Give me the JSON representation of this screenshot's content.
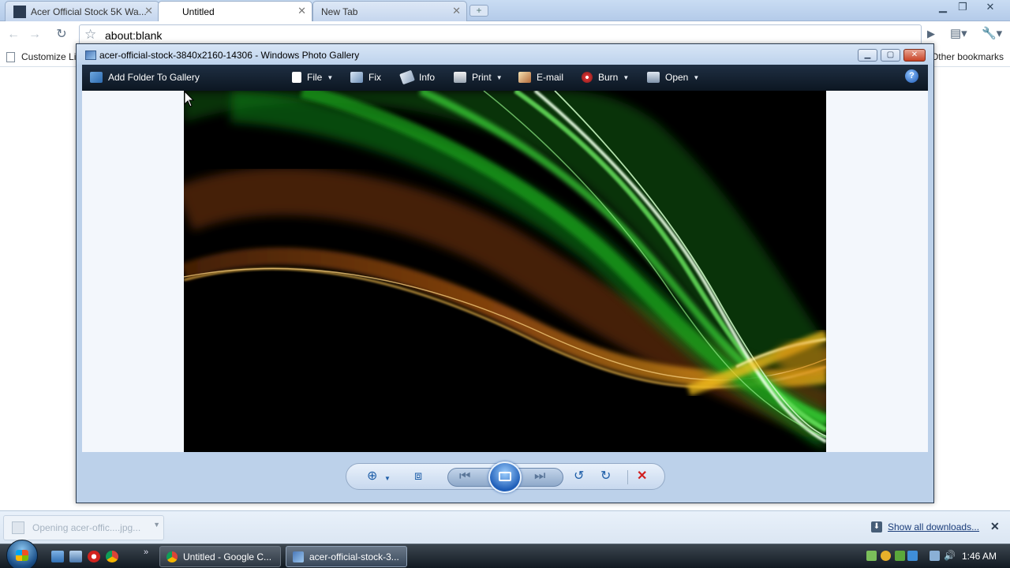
{
  "browser": {
    "tabs": [
      {
        "label": "Acer Official Stock 5K Wa...",
        "active": false
      },
      {
        "label": "Untitled",
        "active": true
      },
      {
        "label": "New Tab",
        "active": false
      }
    ],
    "new_tab_label": "+",
    "address": "about:blank",
    "bookmarks": {
      "customize_label": "Customize Li",
      "other_label": "Other bookmarks"
    }
  },
  "photo_gallery": {
    "title": "acer-official-stock-3840x2160-14306 - Windows Photo Gallery",
    "toolbar": {
      "add_folder": "Add Folder To Gallery",
      "file": "File",
      "fix": "Fix",
      "info": "Info",
      "print": "Print",
      "email": "E-mail",
      "burn": "Burn",
      "open": "Open",
      "help": "?"
    },
    "controls": {
      "zoom": "zoom-icon",
      "fit": "actual-size-icon",
      "previous": "previous-icon",
      "slideshow": "slideshow-icon",
      "next": "next-icon",
      "rotate_left": "rotate-counterclockwise-icon",
      "rotate_right": "rotate-clockwise-icon",
      "delete": "delete-icon"
    }
  },
  "downloads": {
    "item_text": "Opening acer-offic....jpg...",
    "show_all": "Show all downloads..."
  },
  "taskbar": {
    "buttons": [
      {
        "label": "Untitled - Google C..."
      },
      {
        "label": "acer-official-stock-3..."
      }
    ],
    "clock": "1:46 AM"
  },
  "colors": {
    "accent_blue": "#1e5ea8",
    "delete_red": "#d11f1f",
    "command_bar": "#0c1622"
  }
}
